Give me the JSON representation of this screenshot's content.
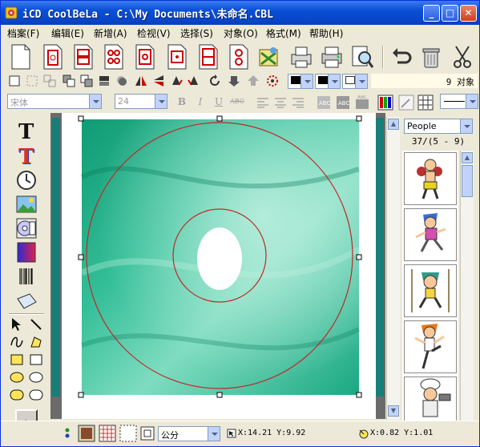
{
  "window": {
    "title": "iCD CoolBeLa - C:\\My Documents\\未命名.CBL",
    "minimize_label": "_",
    "maximize_label": "□",
    "close_label": "✕"
  },
  "menu": [
    {
      "label": "档案(F)"
    },
    {
      "label": "编辑(E)"
    },
    {
      "label": "新增(A)"
    },
    {
      "label": "检视(V)"
    },
    {
      "label": "选择(S)"
    },
    {
      "label": "对象(O)"
    },
    {
      "label": "格式(M)"
    },
    {
      "label": "帮助(H)"
    }
  ],
  "toolbar": {
    "object_count": "9 对象"
  },
  "format_bar": {
    "font_name": "宋体",
    "font_size": "24",
    "bold": "B",
    "italic": "I",
    "underline": "U",
    "strike": "ABC",
    "bold_btn": "B"
  },
  "library": {
    "category": "People",
    "page_info": "37/(5 - 9)",
    "items": [
      {
        "name": "boxer"
      },
      {
        "name": "runner"
      },
      {
        "name": "gymnast"
      },
      {
        "name": "kung-fu"
      },
      {
        "name": "chef"
      }
    ]
  },
  "status": {
    "unit": "公分",
    "cursor_pos": "X:14.21 Y:9.92",
    "obj_pos": "X:0.82 Y:1.01"
  },
  "colors": {
    "disc_outer": "#c0282a",
    "canvas_bg": "#6b6b6b",
    "teal_border": "#157f78",
    "silk_green": "#2fb58f"
  }
}
